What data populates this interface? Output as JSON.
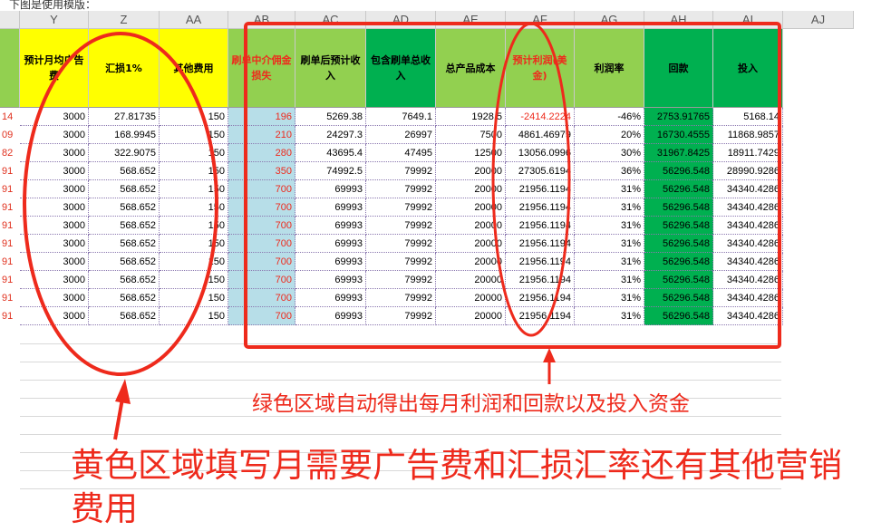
{
  "top_note": "下图是使用模版：",
  "columns": [
    {
      "letter": "Y",
      "header": "预计月均广告费"
    },
    {
      "letter": "Z",
      "header": "汇损1%"
    },
    {
      "letter": "AA",
      "header": "其他费用"
    },
    {
      "letter": "AB",
      "header": "刷单中介佣金损失"
    },
    {
      "letter": "AC",
      "header": "刷单后预计收入"
    },
    {
      "letter": "AD",
      "header": "包含刷单总收入"
    },
    {
      "letter": "AE",
      "header": "总产品成本"
    },
    {
      "letter": "AF",
      "header": "预计利润(美金)"
    },
    {
      "letter": "AG",
      "header": "利润率"
    },
    {
      "letter": "AH",
      "header": "回款"
    },
    {
      "letter": "AI",
      "header": "投入"
    },
    {
      "letter": "AJ",
      "header": ""
    }
  ],
  "row_labels": [
    "14",
    "09",
    "82",
    "91",
    "91",
    "91",
    "91",
    "91",
    "91",
    "91",
    "91",
    "91"
  ],
  "rows": [
    [
      "3000",
      "27.81735",
      "150",
      "196",
      "5269.38",
      "7649.1",
      "1928.5",
      "-2414.2224",
      "-46%",
      "2753.91765",
      "5168.14"
    ],
    [
      "3000",
      "168.9945",
      "150",
      "210",
      "24297.3",
      "26997",
      "7500",
      "4861.46979",
      "20%",
      "16730.4555",
      "11868.9857"
    ],
    [
      "3000",
      "322.9075",
      "150",
      "280",
      "43695.4",
      "47495",
      "12500",
      "13056.0996",
      "30%",
      "31967.8425",
      "18911.7429"
    ],
    [
      "3000",
      "568.652",
      "150",
      "350",
      "74992.5",
      "79992",
      "20000",
      "27305.6194",
      "36%",
      "56296.548",
      "28990.9286"
    ],
    [
      "3000",
      "568.652",
      "150",
      "700",
      "69993",
      "79992",
      "20000",
      "21956.1194",
      "31%",
      "56296.548",
      "34340.4286"
    ],
    [
      "3000",
      "568.652",
      "150",
      "700",
      "69993",
      "79992",
      "20000",
      "21956.1194",
      "31%",
      "56296.548",
      "34340.4286"
    ],
    [
      "3000",
      "568.652",
      "150",
      "700",
      "69993",
      "79992",
      "20000",
      "21956.1194",
      "31%",
      "56296.548",
      "34340.4286"
    ],
    [
      "3000",
      "568.652",
      "150",
      "700",
      "69993",
      "79992",
      "20000",
      "21956.1194",
      "31%",
      "56296.548",
      "34340.4286"
    ],
    [
      "3000",
      "568.652",
      "150",
      "700",
      "69993",
      "79992",
      "20000",
      "21956.1194",
      "31%",
      "56296.548",
      "34340.4286"
    ],
    [
      "3000",
      "568.652",
      "150",
      "700",
      "69993",
      "79992",
      "20000",
      "21956.1194",
      "31%",
      "56296.548",
      "34340.4286"
    ],
    [
      "3000",
      "568.652",
      "150",
      "700",
      "69993",
      "79992",
      "20000",
      "21956.1194",
      "31%",
      "56296.548",
      "34340.4286"
    ],
    [
      "3000",
      "568.652",
      "150",
      "700",
      "69993",
      "79992",
      "20000",
      "21956.1194",
      "31%",
      "56296.548",
      "34340.4286"
    ]
  ],
  "annotations": {
    "green_note": "绿色区域自动得出每月利润和回款以及投入资金",
    "yellow_note": "黄色区域填写月需要广告费和汇损汇率还有其他营销费用"
  },
  "colors": {
    "yellow": "#ffff00",
    "light_green": "#92d050",
    "green": "#00b050",
    "light_blue": "#b7dee8",
    "annotation_red": "#ee2a1c"
  }
}
